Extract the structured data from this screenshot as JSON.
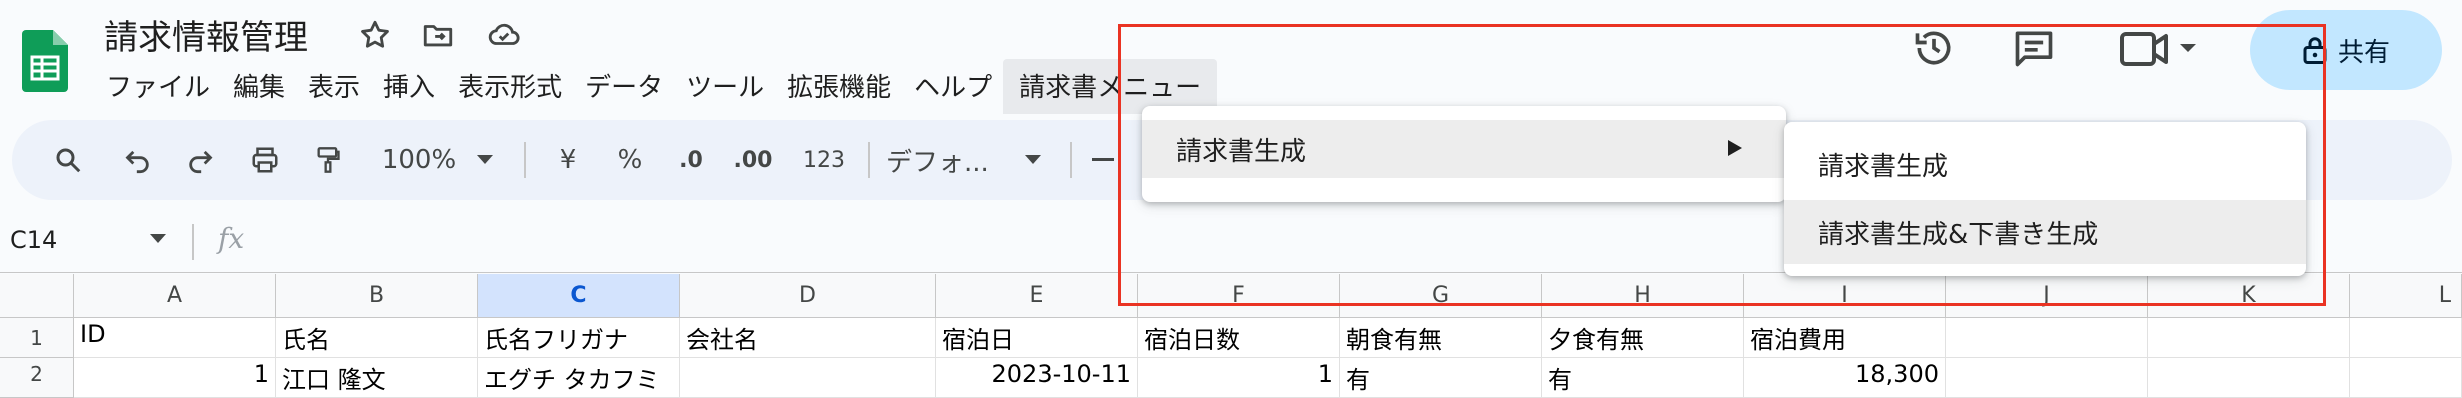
{
  "app": {
    "title": "請求情報管理"
  },
  "menubar": {
    "items": [
      "ファイル",
      "編集",
      "表示",
      "挿入",
      "表示形式",
      "データ",
      "ツール",
      "拡張機能",
      "ヘルプ"
    ],
    "custom_menu": "請求書メニュー"
  },
  "header": {
    "share_label": "共有"
  },
  "toolbar": {
    "zoom": "100%",
    "currency": "¥",
    "percent": "%",
    "dec_decrease": ".0",
    "dec_increase": ".00",
    "number_format": "123",
    "font": "デフォ..."
  },
  "formula_bar": {
    "cell_ref": "C14",
    "fx": "fx",
    "value": ""
  },
  "grid": {
    "columns": [
      "A",
      "B",
      "C",
      "D",
      "E",
      "F",
      "G",
      "H",
      "I",
      "J",
      "K",
      "L"
    ],
    "selected_column": "C",
    "rows": [
      {
        "num": "1",
        "cells": [
          "ID",
          "氏名",
          "氏名フリガナ",
          "会社名",
          "宿泊日",
          "宿泊日数",
          "朝食有無",
          "夕食有無",
          "宿泊費用",
          "",
          "",
          ""
        ]
      },
      {
        "num": "2",
        "cells": [
          "1",
          "江口 隆文",
          "エグチ タカフミ",
          "",
          "2023-10-11",
          "1",
          "有",
          "有",
          "18,300",
          "",
          "",
          ""
        ]
      }
    ]
  },
  "custom_menu_dropdown": {
    "items": [
      {
        "label": "請求書生成",
        "has_submenu": true
      }
    ]
  },
  "submenu": {
    "items": [
      "請求書生成",
      "請求書生成&下書き生成"
    ]
  },
  "colors": {
    "accent": "#0b57d0",
    "share_bg": "#c2e7ff",
    "toolbar_bg": "#edf2fa",
    "selected_col_bg": "#d3e3fd",
    "highlight_box": "#ea3323",
    "sheets_green": "#0f9d58"
  },
  "icons": {
    "toolbar": [
      "search-icon",
      "undo-icon",
      "redo-icon",
      "print-icon",
      "paint-format-icon"
    ],
    "header": [
      "history-icon",
      "comment-icon",
      "meet-icon",
      "lock-icon"
    ],
    "title": [
      "star-icon",
      "move-folder-icon",
      "cloud-saved-icon"
    ]
  }
}
